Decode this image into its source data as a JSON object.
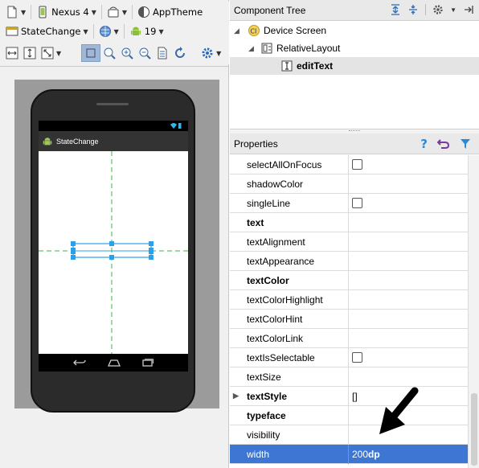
{
  "toolbar": {
    "device": "Nexus 4",
    "theme": "AppTheme",
    "activity": "StateChange",
    "api_level": "19"
  },
  "preview": {
    "app_title": "StateChange"
  },
  "component_tree": {
    "title": "Component Tree",
    "items": [
      {
        "label": "Device Screen",
        "icon": "device-screen-icon"
      },
      {
        "label": "RelativeLayout",
        "icon": "relative-layout-icon"
      },
      {
        "label": "editText",
        "icon": "edittext-icon"
      }
    ]
  },
  "properties": {
    "title": "Properties",
    "rows": [
      {
        "name": "selectAllOnFocus",
        "value": "",
        "checkbox": true
      },
      {
        "name": "shadowColor",
        "value": ""
      },
      {
        "name": "singleLine",
        "value": "",
        "checkbox": true
      },
      {
        "name": "text",
        "value": "",
        "bold": true
      },
      {
        "name": "textAlignment",
        "value": ""
      },
      {
        "name": "textAppearance",
        "value": ""
      },
      {
        "name": "textColor",
        "value": "",
        "bold": true
      },
      {
        "name": "textColorHighlight",
        "value": ""
      },
      {
        "name": "textColorHint",
        "value": ""
      },
      {
        "name": "textColorLink",
        "value": ""
      },
      {
        "name": "textIsSelectable",
        "value": "",
        "checkbox": true
      },
      {
        "name": "textSize",
        "value": ""
      },
      {
        "name": "textStyle",
        "value": "[]",
        "bold": true
      },
      {
        "name": "typeface",
        "value": "",
        "bold": true
      },
      {
        "name": "visibility",
        "value": ""
      },
      {
        "name": "width",
        "value": "200",
        "unit": "dp",
        "selected": true
      }
    ]
  },
  "colors": {
    "selection": "#3d77d3",
    "guide": "#3cb44a",
    "handle": "#2aa0e8",
    "arrow": "#000000"
  }
}
